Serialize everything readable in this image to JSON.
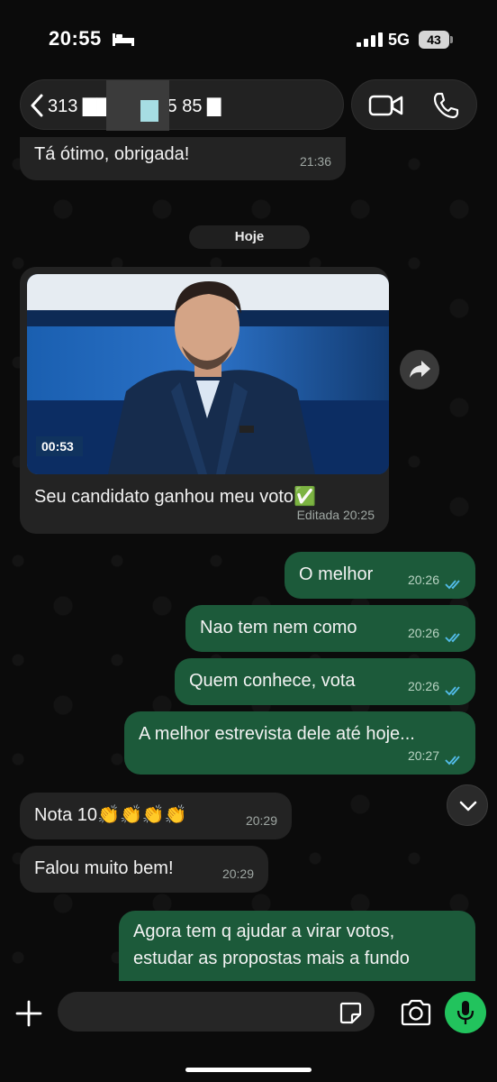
{
  "status_bar": {
    "time": "20:55",
    "network": "5G",
    "battery": "43"
  },
  "header": {
    "contact_name": "313 ▇▇▇▇▇ 55 85 ▇",
    "back_icon": "chevron-left-icon",
    "video_icon": "video-camera-icon",
    "phone_icon": "phone-icon"
  },
  "chat": {
    "date_separator": "Hoje",
    "messages": [
      {
        "direction": "in",
        "text": "Tá ótimo, obrigada!",
        "time": "21:36"
      },
      {
        "direction": "in",
        "has_image": true,
        "text": "Seu candidato ganhou meu voto✅",
        "time": "Editada 20:25",
        "image_overlay": "00:53"
      },
      {
        "direction": "out",
        "text": "O melhor",
        "time": "20:26"
      },
      {
        "direction": "out",
        "text": "Nao tem nem como",
        "time": "20:26"
      },
      {
        "direction": "out",
        "text": "Quem conhece, vota",
        "time": "20:26"
      },
      {
        "direction": "out",
        "text": "A melhor estrevista dele até hoje...",
        "time": "20:27"
      },
      {
        "direction": "in",
        "text": "Nota 10👏👏👏👏",
        "time": "20:29"
      },
      {
        "direction": "in",
        "text": "Falou muito bem!",
        "time": "20:29"
      },
      {
        "direction": "out",
        "text_lines": [
          "Agora tem q ajudar a virar votos,",
          "estudar as propostas mais a fundo"
        ]
      }
    ]
  },
  "input": {
    "placeholder": "",
    "plus_icon": "plus-icon",
    "sticker_icon": "sticker-icon",
    "camera_icon": "camera-icon",
    "mic_icon": "microphone-icon"
  },
  "colors": {
    "incoming_bubble": "#232323",
    "outgoing_bubble": "#1c5a3a",
    "read_ticks": "#53bdeb",
    "mic_button": "#22c35d"
  }
}
